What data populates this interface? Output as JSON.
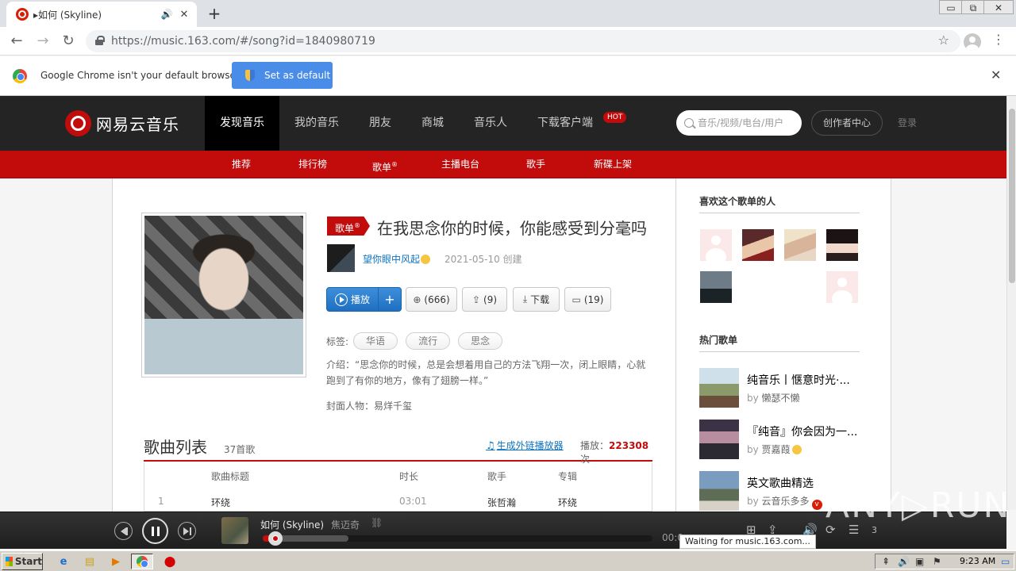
{
  "browser": {
    "tab_title": "▸如何 (Skyline)",
    "tab_speaker": "🔊",
    "tab_close": "✕",
    "new_tab": "+",
    "win_min": "▭",
    "win_max": "⧉",
    "win_close": "✕",
    "back": "←",
    "forward": "→",
    "reload": "↻",
    "url": "https://music.163.com/#/song?id=1840980719",
    "bookmark": "☆",
    "menu": "⋮",
    "infobar_text": "Google Chrome isn't your default browser",
    "set_default_label": "Set as default",
    "infobar_close": "✕"
  },
  "site": {
    "logo_text": "网易云音乐",
    "nav": [
      {
        "label": "发现音乐",
        "active": true
      },
      {
        "label": "我的音乐"
      },
      {
        "label": "朋友"
      },
      {
        "label": "商城"
      },
      {
        "label": "音乐人"
      },
      {
        "label": "下载客户端"
      }
    ],
    "hot_badge": "HOT",
    "search_placeholder": "音乐/视频/电台/用户",
    "creator_center": "创作者中心",
    "login": "登录",
    "subnav": [
      "推荐",
      "排行榜",
      "歌单",
      "主播电台",
      "歌手",
      "新碟上架"
    ],
    "subnav_sup": "®"
  },
  "playlist": {
    "badge": "歌单",
    "badge_sup": "®",
    "title": "在我思念你的时候，你能感受到分毫吗",
    "creator": "望你眼中风起",
    "created": "2021-05-10 创建",
    "play_label": "播放",
    "add_label": "+",
    "collect_icon": "⊕",
    "collect_label": "(666)",
    "share_icon": "⇪",
    "share_label": "(9)",
    "download_icon": "⤓",
    "download_label": "下载",
    "comment_icon": "▭",
    "comment_label": "(19)",
    "tags_label": "标签:",
    "tags": [
      "华语",
      "流行",
      "思念"
    ],
    "intro": "介绍：“思念你的时候，总是会想着用自己的方法飞翔一次，闭上眼睛，心就跑到了有你的地方，像有了翅膀一样。”",
    "cover_person": "封面人物：易烊千玺"
  },
  "songlist": {
    "title": "歌曲列表",
    "count": "37首歌",
    "outchain_icon": "♫",
    "outchain": "生成外链播放器",
    "play_count_label": "播放：",
    "play_count": "223308",
    "play_count_unit": "次",
    "headers": [
      "歌曲标题",
      "时长",
      "歌手",
      "专辑"
    ],
    "rows": [
      {
        "idx": "1",
        "title": "环绕",
        "duration": "03:01",
        "artist": "张哲瀚",
        "album": "环绕"
      }
    ]
  },
  "sidebar": {
    "likers_title": "喜欢这个歌单的人",
    "hot_title": "热门歌单",
    "hot": [
      {
        "name": "纯音乐丨惬意时光·...",
        "by": "by",
        "user": "懒瑟不懒"
      },
      {
        "name": "『纯音』你会因为一...",
        "by": "by",
        "user": "贾嘉葭"
      },
      {
        "name": "英文歌曲精选",
        "by": "by",
        "user": "云音乐多多",
        "badge": "v"
      }
    ]
  },
  "player": {
    "song": "如何 (Skyline)",
    "artist": "焦迈奇",
    "link": "⛓",
    "time": "00:0",
    "progress_played": 0.03,
    "progress_buffered": 0.22,
    "collect_icon": "⊞",
    "share_icon": "⇪",
    "volume_icon": "🔊",
    "loop_icon": "⟳",
    "playlist_icon": "☰",
    "playlist_count": "3"
  },
  "status_tip": "Waiting for music.163.com...",
  "watermark": "ANY▷RUN",
  "taskbar": {
    "start": "Start",
    "clock": "9:23 AM",
    "ie_icon": "e",
    "folder_icon": "▤",
    "media_icon": "▶",
    "stop_icon": "⬤",
    "tray_icons": [
      "⇞",
      "🔊",
      "▣",
      "⚑",
      "▭"
    ]
  },
  "colors": {
    "brand_red": "#c20c0c",
    "header_dark": "#242424",
    "link_blue": "#0c73c2"
  }
}
